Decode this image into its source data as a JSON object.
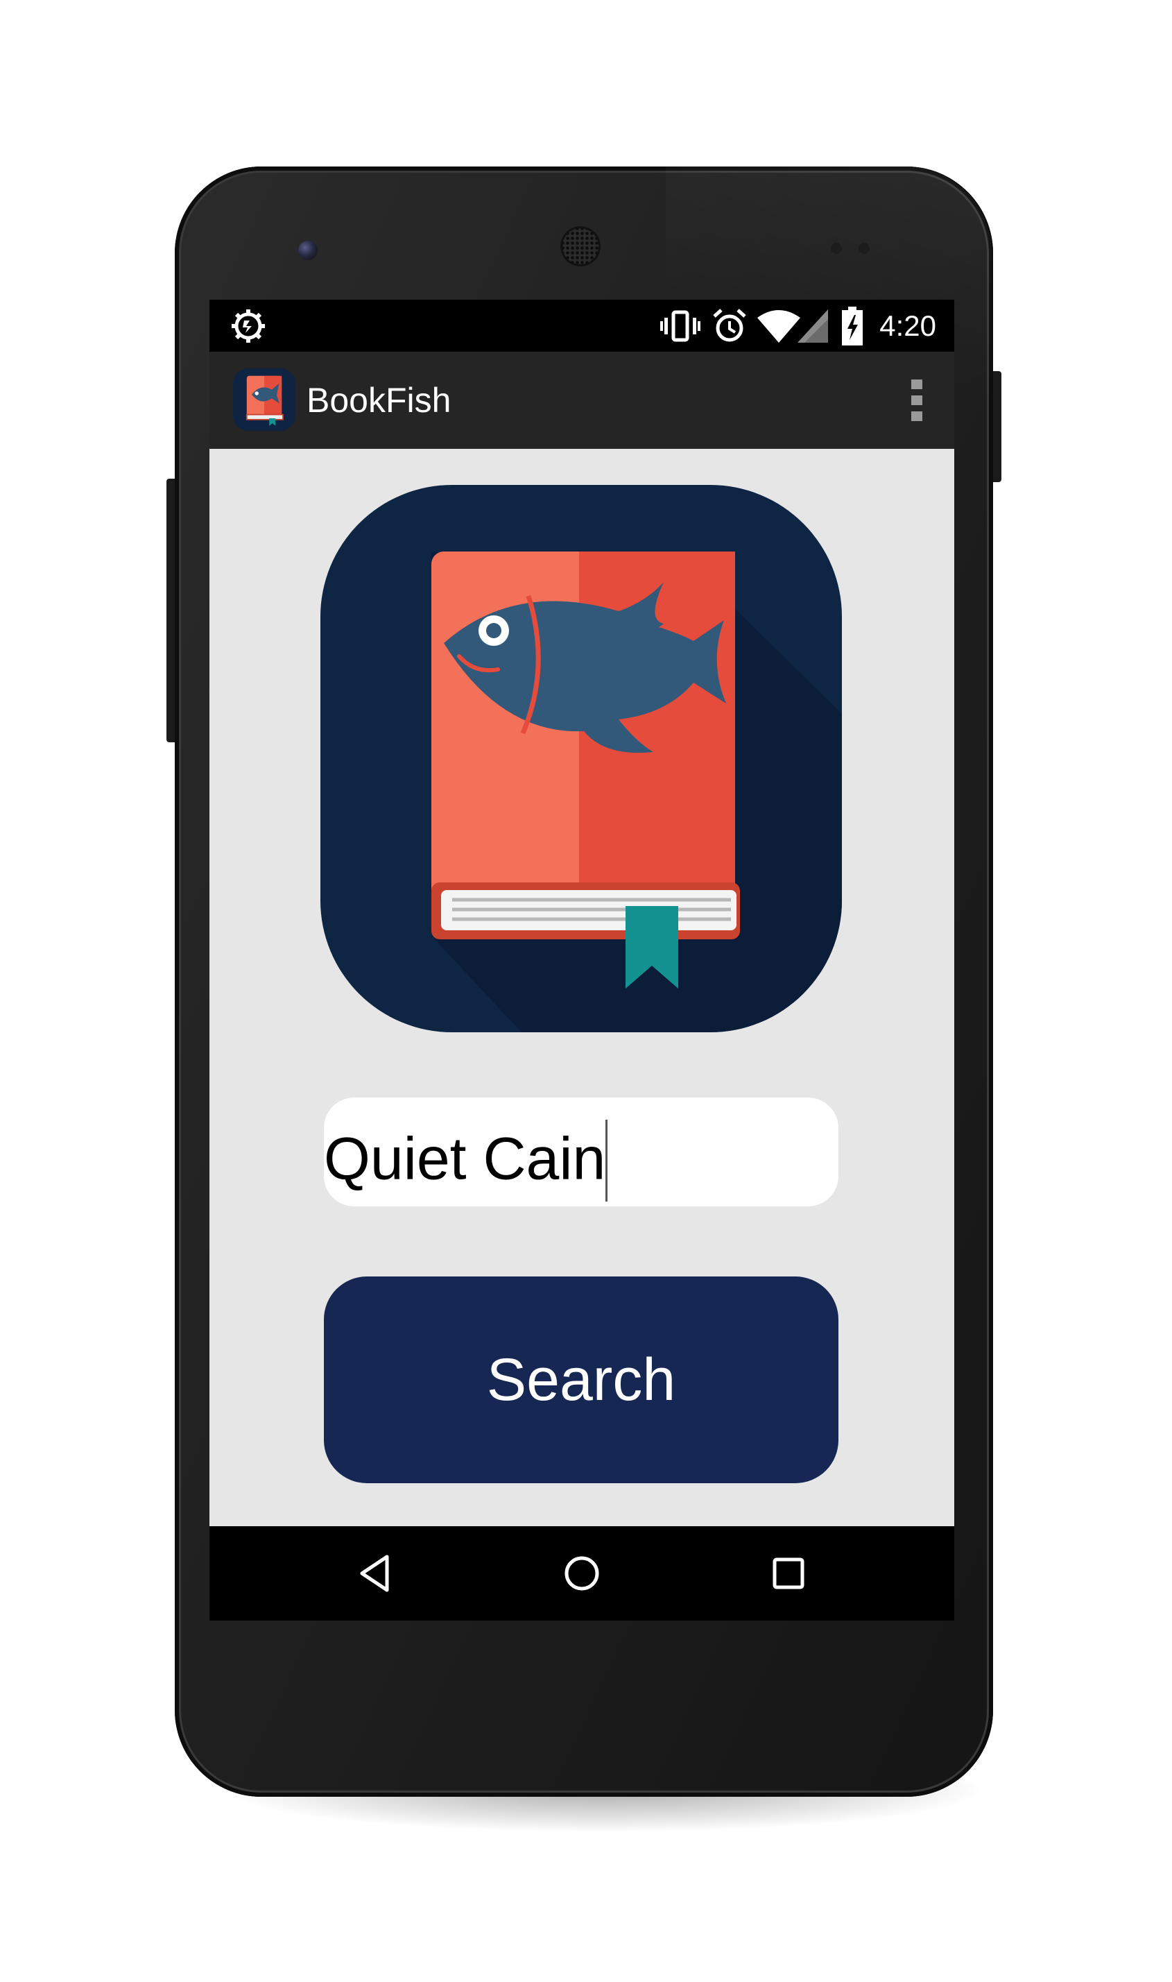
{
  "status_bar": {
    "time": "4:20",
    "icons": [
      "sync-settings-icon",
      "vibrate-icon",
      "alarm-icon",
      "wifi-icon",
      "signal-icon",
      "battery-charging-icon"
    ]
  },
  "action_bar": {
    "title": "BookFish",
    "app_icon": "bookfish-logo-icon",
    "overflow_icon": "overflow-menu-icon"
  },
  "main": {
    "logo": "bookfish-logo",
    "search_input": {
      "value": "Quiet Cain",
      "placeholder": ""
    },
    "search_button_label": "Search"
  },
  "nav_bar": {
    "buttons": [
      "back-icon",
      "home-icon",
      "recents-icon"
    ]
  },
  "colors": {
    "logo_background": "#0e2442",
    "book_cover_light": "#f37158",
    "book_cover_dark": "#e64c3c",
    "fish": "#32597a",
    "bookmark": "#149191",
    "search_button": "#172753",
    "content_background": "#e6e6e6",
    "action_bar": "#252525"
  }
}
